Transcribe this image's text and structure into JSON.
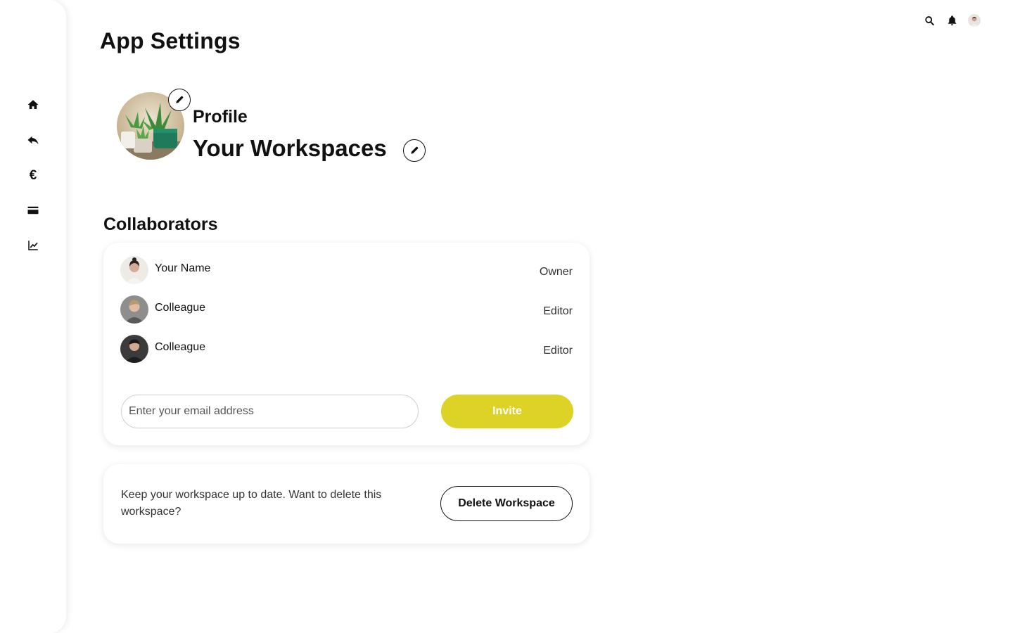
{
  "page": {
    "title": "App Settings"
  },
  "sidebar": {
    "items": [
      {
        "name": "home",
        "icon": "home-icon"
      },
      {
        "name": "back",
        "icon": "reply-icon"
      },
      {
        "name": "currency",
        "icon": "euro-icon",
        "glyph": "€"
      },
      {
        "name": "cards",
        "icon": "credit-card-icon"
      },
      {
        "name": "analytics",
        "icon": "chart-line-icon"
      }
    ]
  },
  "topbar": {
    "icons": [
      "search-icon",
      "bell-icon",
      "user-avatar"
    ]
  },
  "profile": {
    "label": "Profile",
    "workspace_name": "Your Workspaces"
  },
  "collaborators": {
    "title": "Collaborators",
    "people": [
      {
        "name": "Your Name",
        "role": "Owner"
      },
      {
        "name": "Colleague",
        "role": "Editor"
      },
      {
        "name": "Colleague",
        "role": "Editor"
      }
    ],
    "email_placeholder": "Enter your email address",
    "invite_label": "Invite"
  },
  "delete_section": {
    "text": "Keep your workspace up to date. Want to delete this workspace?",
    "button_label": "Delete Workspace"
  },
  "colors": {
    "accent": "#ddd226",
    "text": "#111111",
    "background": "#ffffff"
  }
}
